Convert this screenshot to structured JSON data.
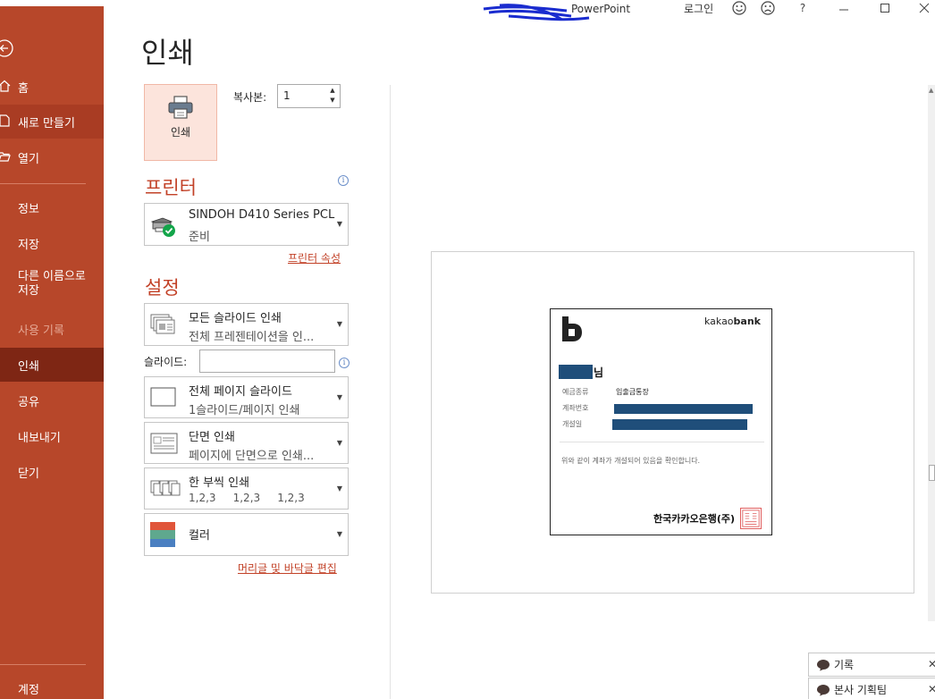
{
  "window": {
    "app_title": "PowerPoint",
    "login": "로그인",
    "icons": [
      "smiley-icon",
      "frown-icon",
      "help-icon",
      "minimize-icon",
      "maximize-icon",
      "close-icon"
    ],
    "help_glyph": "?"
  },
  "sidebar": {
    "items": [
      {
        "label": "홈",
        "icon": "home-icon"
      },
      {
        "label": "새로 만들기",
        "icon": "new-file-icon"
      },
      {
        "label": "열기",
        "icon": "open-folder-icon"
      },
      {
        "label": "정보"
      },
      {
        "label": "저장"
      },
      {
        "label": "다른 이름으로 저장"
      },
      {
        "label": "사용 기록"
      },
      {
        "label": "인쇄"
      },
      {
        "label": "공유"
      },
      {
        "label": "내보내기"
      },
      {
        "label": "닫기"
      },
      {
        "label": "계정"
      }
    ]
  },
  "print": {
    "title": "인쇄",
    "print_button": "인쇄",
    "copies_label": "복사본:",
    "copies_value": "1",
    "printer_heading": "프린터",
    "printer_name": "SINDOH D410 Series PCL",
    "printer_status": "준비",
    "printer_properties": "프린터 속성",
    "settings_heading": "설정",
    "range_main": "모든 슬라이드 인쇄",
    "range_sub": "전체 프레젠테이션을 인...",
    "slides_label": "슬라이드:",
    "slides_value": "",
    "layout_main": "전체 페이지 슬라이드",
    "layout_sub": "1슬라이드/페이지 인쇄",
    "sides_main": "단면 인쇄",
    "sides_sub": "페이지에 단면으로 인쇄...",
    "collate_main": "한 부씩 인쇄",
    "collate_sub": "1,2,3     1,2,3     1,2,3",
    "color_main": "컬러",
    "header_footer": "머리글 및 바닥글 편집"
  },
  "preview": {
    "brand_prefix": "kakao",
    "brand_bold": "bank",
    "name_suffix": "님",
    "fields": [
      {
        "label": "예금종류",
        "value": "입출금통장"
      },
      {
        "label": "계좌번호",
        "value": ""
      },
      {
        "label": "개설일",
        "value": ""
      }
    ],
    "note": "위와 같이 계좌가 개설되어 있음을 확인합니다.",
    "bank_name": "한국카카오은행(주)"
  },
  "chats": [
    {
      "label": "기록"
    },
    {
      "label": "본사 기획팀"
    }
  ],
  "colors": {
    "sidebar": "#b7472a",
    "sidebar_selected": "#7e2614",
    "accent": "#c24127",
    "redaction": "#1f4e7a"
  }
}
